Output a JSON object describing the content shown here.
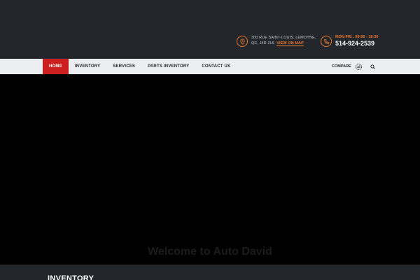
{
  "header": {
    "address_line1": "300 RUE SAINT-LOUIS, LEMOYNE,",
    "address_line2": "QC, J4R 2L6",
    "map_link": "VIEW ON MAP",
    "hours": "MON-FRI : 08:00 - 18:30",
    "phone": "514-924-2539",
    "icons": {
      "address": "location-pin-icon",
      "phone": "phone-icon"
    },
    "accent_color": "#e8772e"
  },
  "nav": {
    "items": [
      {
        "label": "HOME",
        "active": true
      },
      {
        "label": "INVENTORY",
        "active": false
      },
      {
        "label": "SERVICES",
        "active": false
      },
      {
        "label": "PARTS INVENTORY",
        "active": false
      },
      {
        "label": "CONTACT US",
        "active": false
      }
    ],
    "compare_label": "COMPARE",
    "active_color": "#cc2020"
  },
  "hero": {
    "welcome": "Welcome to Auto David"
  },
  "section": {
    "title": "INVENTORY"
  }
}
